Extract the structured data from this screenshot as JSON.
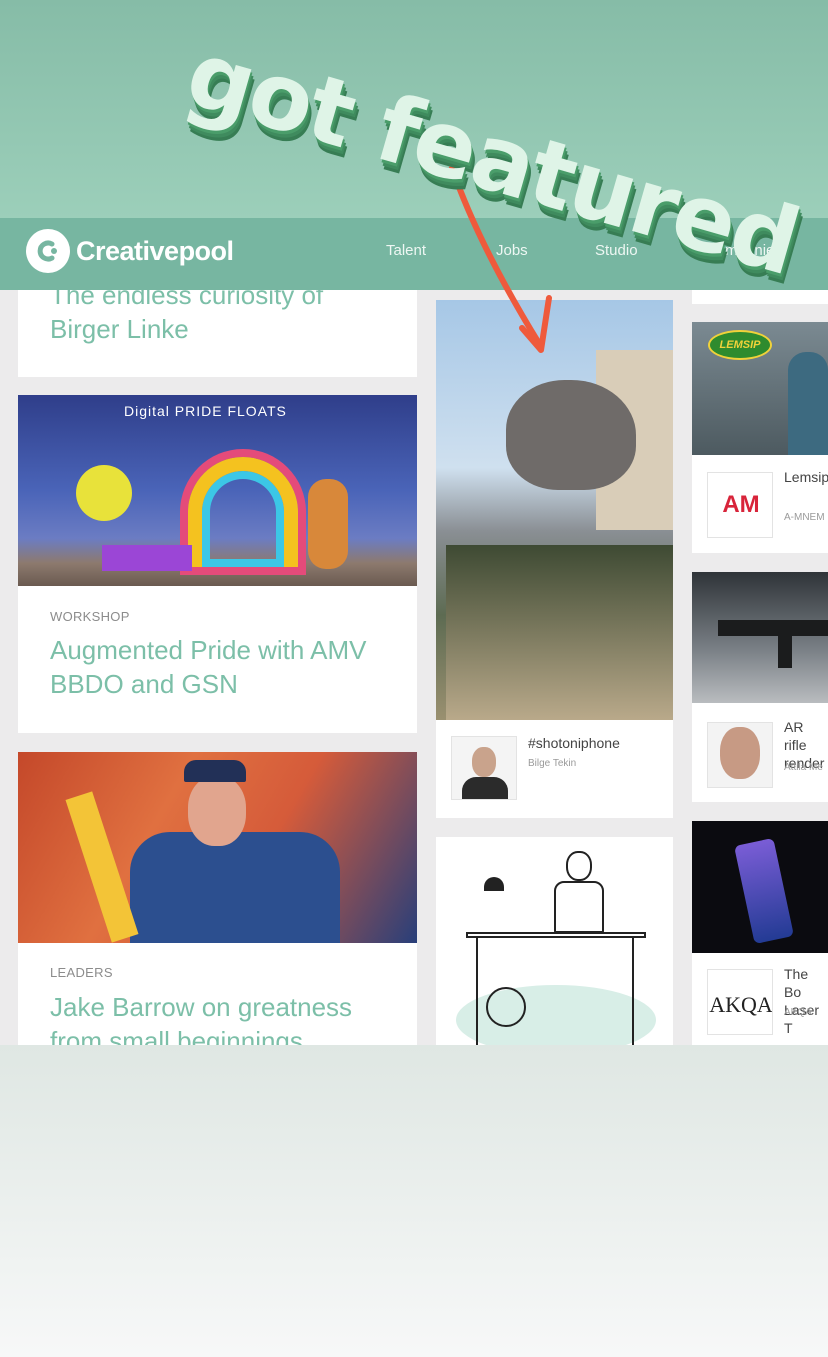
{
  "sticker": {
    "text": "got featured"
  },
  "navbar": {
    "brand": "Creativepool",
    "links": [
      "Talent",
      "Jobs",
      "Studio",
      "Companies"
    ]
  },
  "col1": {
    "card1": {
      "title": "The endless curiosity of Birger Linke"
    },
    "card2": {
      "image_text": "Digital PRIDE FLOATS",
      "kicker": "WORKSHOP",
      "title": "Augmented Pride with AMV BBDO and GSN"
    },
    "card3": {
      "kicker": "LEADERS",
      "title": "Jake Barrow on greatness from small beginnings"
    }
  },
  "col2": {
    "photo": {
      "title": "#shotoniphone",
      "author": "Bilge Tekin"
    }
  },
  "col3": {
    "item1": {
      "logo": "AM",
      "badge": "LEMSIP",
      "title": "Lemsip you\"",
      "sub": "A-MNEM"
    },
    "item2": {
      "title": "AR rifle render",
      "sub": "Attila Me"
    },
    "item3": {
      "logo": "AKQA",
      "title": "The Bo Laser T",
      "sub": "AKQA"
    }
  },
  "colors": {
    "accent": "#7cbfa8",
    "nav": "#77b6a1",
    "arrow": "#ef5a3c"
  }
}
